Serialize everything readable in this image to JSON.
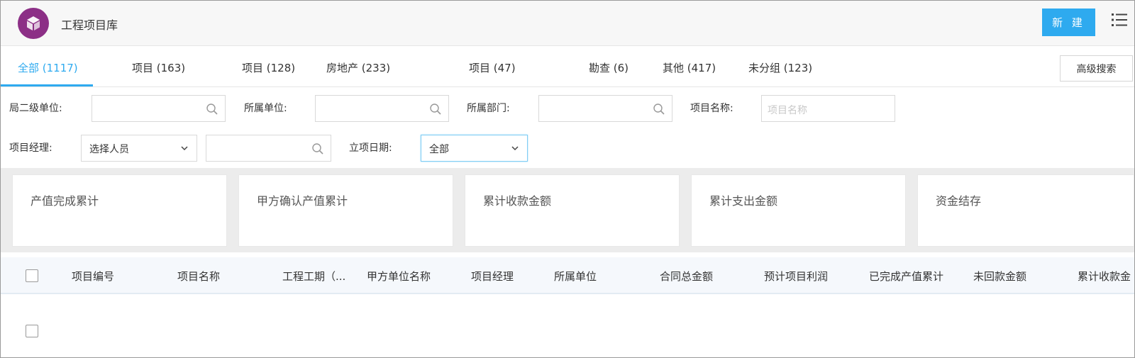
{
  "header": {
    "title": "工程项目库",
    "logo_icon": "cube-icon",
    "logo_color": "#8c2f86",
    "new_button": "新 建",
    "menu_icon": "list-menu-icon"
  },
  "tabs": [
    {
      "label": "全部 (1117)",
      "active": true
    },
    {
      "label": "项目 (163)"
    },
    {
      "label": "项目 (128)"
    },
    {
      "label": "房地产 (233)"
    },
    {
      "label": "项目 (47)"
    },
    {
      "label": "勘查 (6)"
    },
    {
      "label": "其他 (417)"
    },
    {
      "label": "未分组 (123)"
    }
  ],
  "advanced_search": "高级搜索",
  "filters": {
    "bureau_unit_label": "局二级单位:",
    "belong_unit_label": "所属单位:",
    "belong_dept_label": "所属部门:",
    "project_name_label": "项目名称:",
    "project_name_placeholder": "项目名称",
    "manager_label": "项目经理:",
    "manager_select": "选择人员",
    "date_label": "立项日期:",
    "date_select": "全部"
  },
  "cards": [
    {
      "title": "产值完成累计"
    },
    {
      "title": "甲方确认产值累计"
    },
    {
      "title": "累计收款金额"
    },
    {
      "title": "累计支出金额"
    },
    {
      "title": "资金结存"
    }
  ],
  "table": {
    "columns": [
      "项目编号",
      "项目名称",
      "工程工期（...",
      "甲方单位名称",
      "项目经理",
      "所属单位",
      "合同总金额",
      "预计项目利润",
      "已完成产值累计",
      "未回款金额",
      "累计收款金"
    ]
  },
  "colors": {
    "accent": "#2eaaef",
    "header_bg": "#f7f7f7",
    "table_header_bg": "#f5f8fc"
  }
}
